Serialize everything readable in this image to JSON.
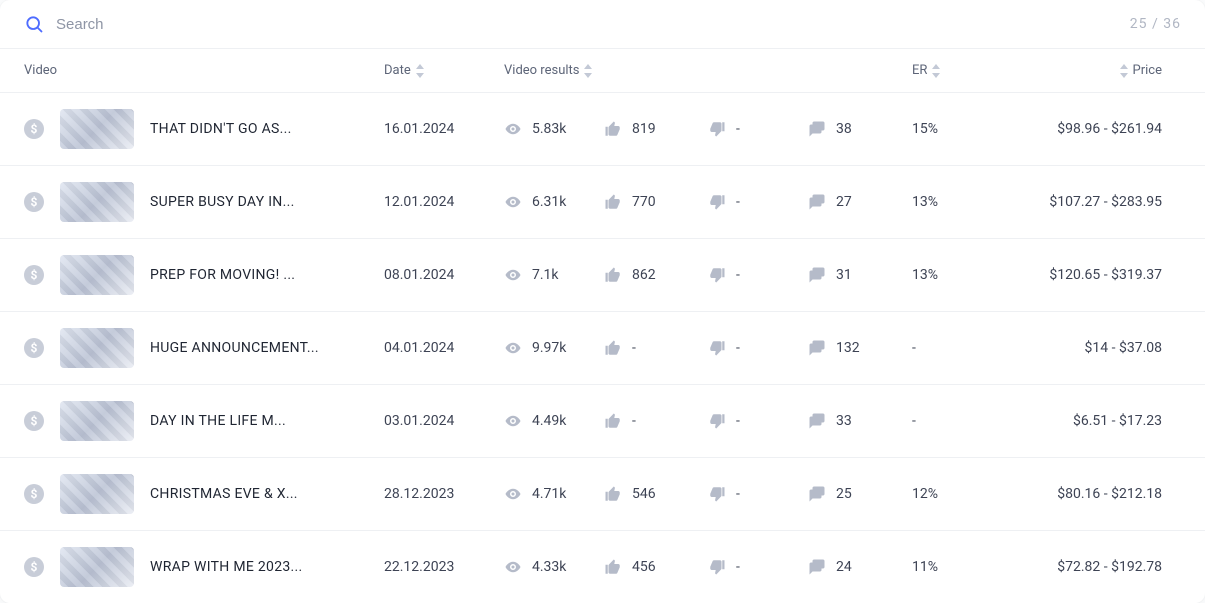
{
  "search": {
    "placeholder": "Search"
  },
  "counter": "25 / 36",
  "columns": {
    "video": "Video",
    "date": "Date",
    "results": "Video results",
    "er": "ER",
    "price": "Price"
  },
  "rows": [
    {
      "title": "THAT DIDN'T GO AS...",
      "date": "16.01.2024",
      "views": "5.83k",
      "likes": "819",
      "dislikes": "-",
      "comments": "38",
      "er": "15%",
      "price": "$98.96 - $261.94"
    },
    {
      "title": "SUPER BUSY DAY IN...",
      "date": "12.01.2024",
      "views": "6.31k",
      "likes": "770",
      "dislikes": "-",
      "comments": "27",
      "er": "13%",
      "price": "$107.27 - $283.95"
    },
    {
      "title": "PREP FOR MOVING! ...",
      "date": "08.01.2024",
      "views": "7.1k",
      "likes": "862",
      "dislikes": "-",
      "comments": "31",
      "er": "13%",
      "price": "$120.65 - $319.37"
    },
    {
      "title": "HUGE ANNOUNCEMENT...",
      "date": "04.01.2024",
      "views": "9.97k",
      "likes": "-",
      "dislikes": "-",
      "comments": "132",
      "er": "-",
      "price": "$14 - $37.08"
    },
    {
      "title": "DAY IN THE LIFE M...",
      "date": "03.01.2024",
      "views": "4.49k",
      "likes": "-",
      "dislikes": "-",
      "comments": "33",
      "er": "-",
      "price": "$6.51 - $17.23"
    },
    {
      "title": "CHRISTMAS EVE & X...",
      "date": "28.12.2023",
      "views": "4.71k",
      "likes": "546",
      "dislikes": "-",
      "comments": "25",
      "er": "12%",
      "price": "$80.16 - $212.18"
    },
    {
      "title": "WRAP WITH ME 2023...",
      "date": "22.12.2023",
      "views": "4.33k",
      "likes": "456",
      "dislikes": "-",
      "comments": "24",
      "er": "11%",
      "price": "$72.82 - $192.78"
    }
  ]
}
